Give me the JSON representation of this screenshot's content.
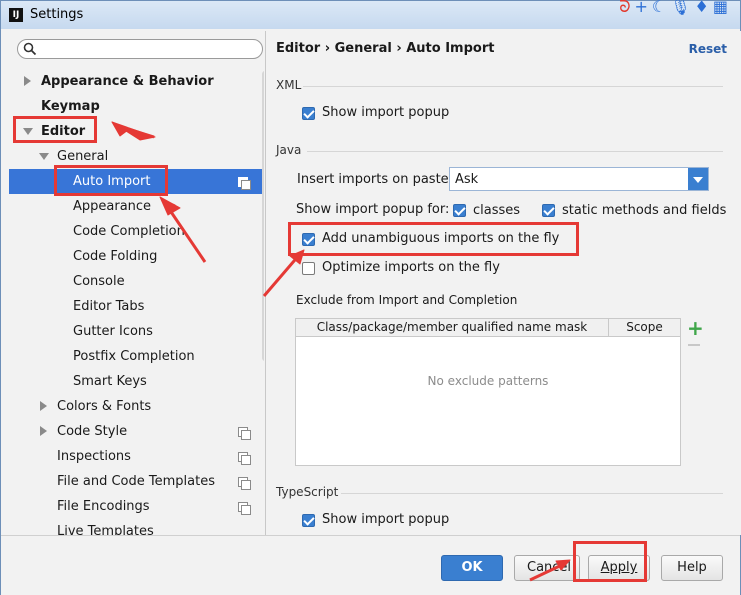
{
  "window": {
    "title": "Settings"
  },
  "search": {
    "placeholder": ""
  },
  "sidebar": {
    "items": [
      {
        "label": "Appearance & Behavior"
      },
      {
        "label": "Keymap"
      },
      {
        "label": "Editor"
      },
      {
        "label": "General"
      },
      {
        "label": "Auto Import"
      },
      {
        "label": "Appearance"
      },
      {
        "label": "Code Completion"
      },
      {
        "label": "Code Folding"
      },
      {
        "label": "Console"
      },
      {
        "label": "Editor Tabs"
      },
      {
        "label": "Gutter Icons"
      },
      {
        "label": "Postfix Completion"
      },
      {
        "label": "Smart Keys"
      },
      {
        "label": "Colors & Fonts"
      },
      {
        "label": "Code Style"
      },
      {
        "label": "Inspections"
      },
      {
        "label": "File and Code Templates"
      },
      {
        "label": "File Encodings"
      },
      {
        "label": "Live Templates"
      }
    ]
  },
  "content": {
    "breadcrumb": "Editor › General › Auto Import",
    "reset": "Reset",
    "xml": {
      "section": "XML",
      "show_popup": {
        "label": "Show import popup",
        "checked": true
      }
    },
    "java": {
      "section": "Java",
      "insert_label": "Insert imports on paste:",
      "insert_value": "Ask",
      "popup_for_label": "Show import popup for:",
      "classes": {
        "label": "classes",
        "checked": true
      },
      "static": {
        "label": "static methods and fields",
        "checked": true
      },
      "add_unambiguous": {
        "label": "Add unambiguous imports on the fly",
        "checked": true
      },
      "optimize": {
        "label": "Optimize imports on the fly",
        "checked": false
      }
    },
    "exclude": {
      "section": "Exclude from Import and Completion",
      "columns": [
        "Class/package/member qualified name mask",
        "Scope"
      ],
      "empty_text": "No exclude patterns"
    },
    "typescript": {
      "section": "TypeScript",
      "show_popup": {
        "label": "Show import popup",
        "checked": true
      }
    }
  },
  "footer": {
    "ok": "OK",
    "cancel": "Cancel",
    "apply": "Apply",
    "help": "Help"
  },
  "colors": {
    "accent": "#3875d7",
    "annotation": "#e53935"
  }
}
